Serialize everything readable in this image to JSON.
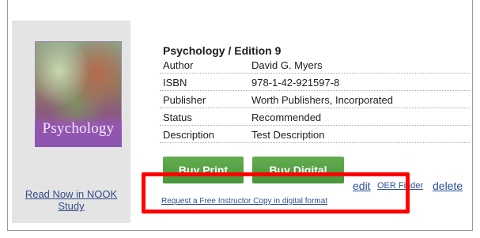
{
  "book": {
    "cover_title": "Psychology",
    "title": "Psychology / Edition 9",
    "details": [
      {
        "label": "Author",
        "value": "David G. Myers"
      },
      {
        "label": "ISBN",
        "value": "978-1-42-921597-8"
      },
      {
        "label": "Publisher",
        "value": "Worth Publishers, Incorporated"
      },
      {
        "label": "Status",
        "value": "Recommended"
      },
      {
        "label": "Description",
        "value": "Test Description"
      }
    ]
  },
  "actions": {
    "buy_print": "Buy Print",
    "buy_digital": "Buy Digital",
    "edit": "edit",
    "oer_finder": "OER Finder",
    "delete": "delete",
    "request_copy": "Request a Free Instructor Copy in digital format"
  },
  "left_panel": {
    "nook_link": "Read Now in NOOK Study"
  },
  "colors": {
    "button_green": "#4f9f42",
    "link_blue": "#2c4f9a",
    "highlight_red": "#ff0000"
  }
}
